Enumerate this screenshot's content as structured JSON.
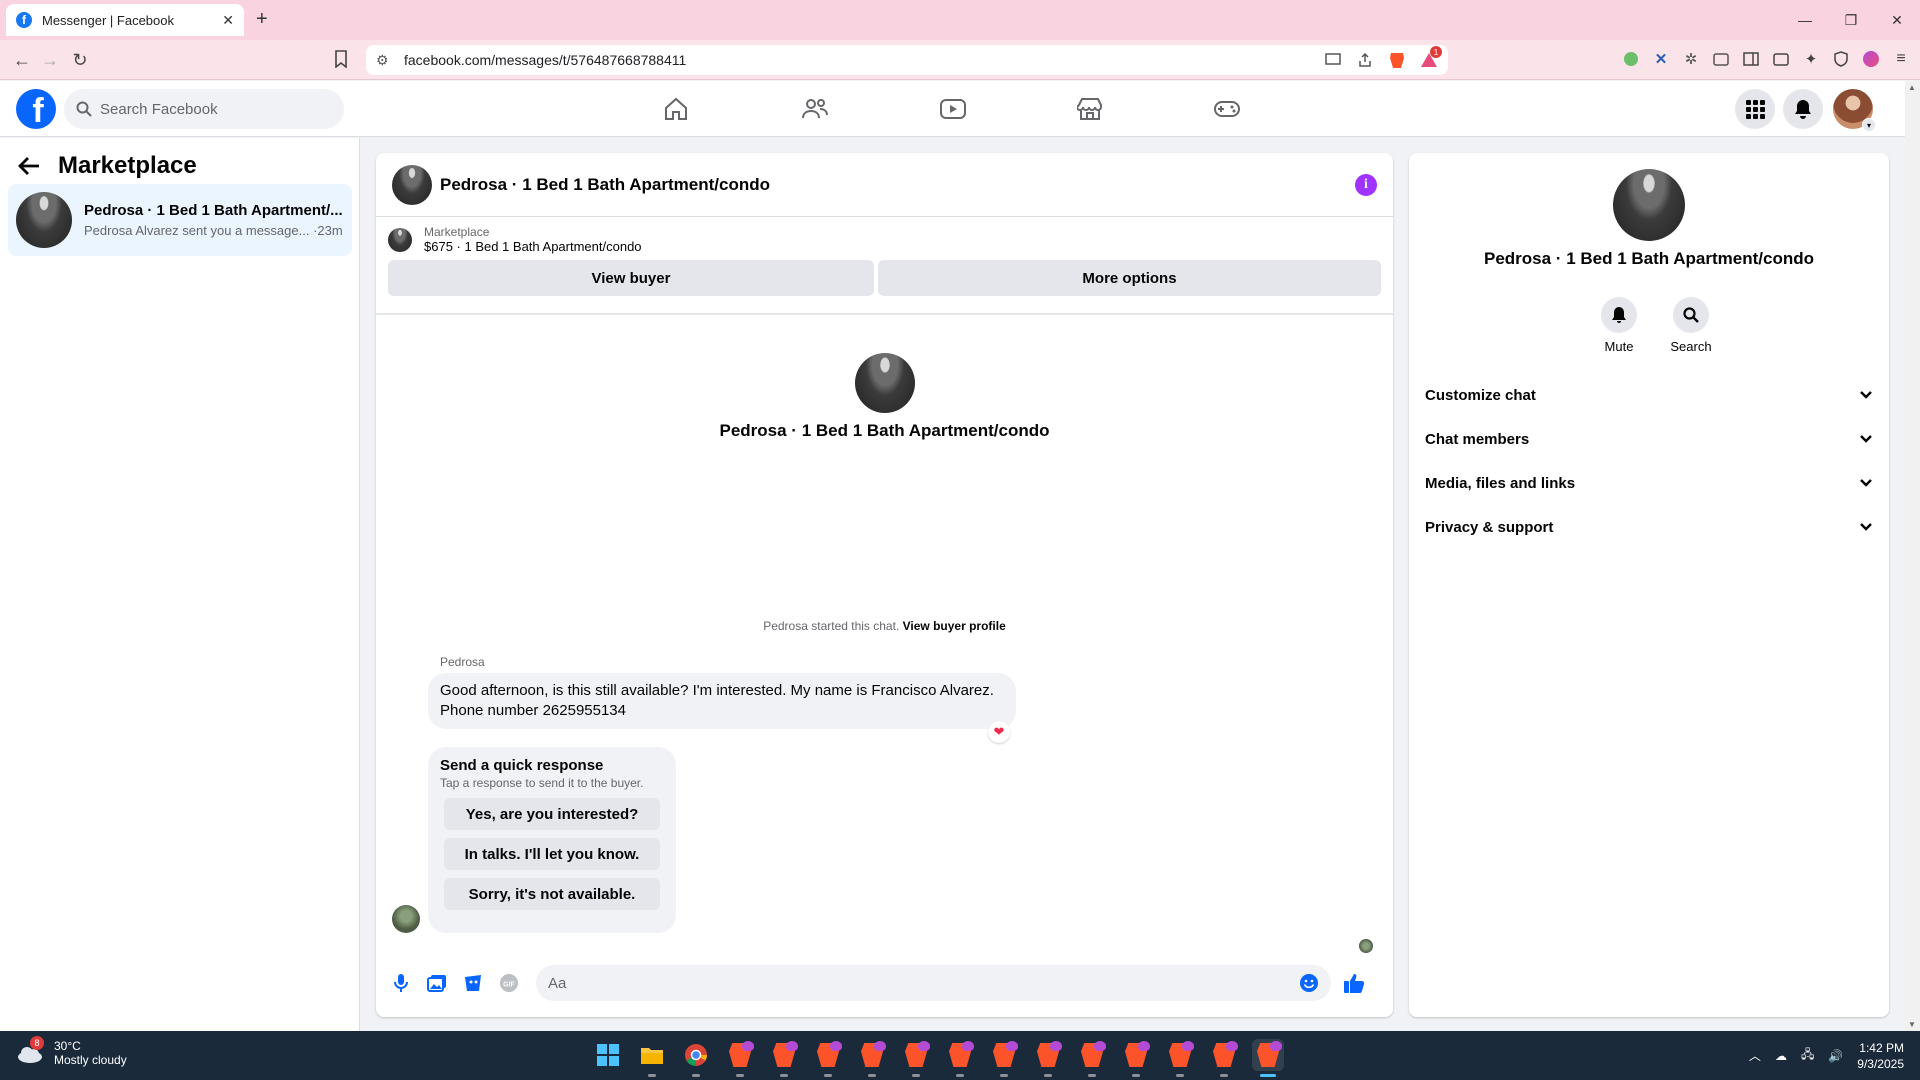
{
  "browser": {
    "tab_title": "Messenger | Facebook",
    "url": "facebook.com/messages/t/576487668788411",
    "ext_badge": "1"
  },
  "fb": {
    "search_placeholder": "Search Facebook",
    "nav": [
      "home-icon",
      "friends-icon",
      "watch-icon",
      "marketplace-icon",
      "gaming-icon"
    ]
  },
  "sidebar": {
    "title": "Marketplace",
    "conversation": {
      "name": "Pedrosa · 1 Bed 1 Bath Apartment/...",
      "preview": "Pedrosa Alvarez sent you a message... ·23m"
    }
  },
  "chat": {
    "title": "Pedrosa · 1 Bed 1 Bath Apartment/condo",
    "listing_category": "Marketplace",
    "listing_price": "$675 · 1 Bed 1 Bath Apartment/condo",
    "view_buyer": "View buyer",
    "more_options": "More options",
    "intro_name": "Pedrosa · 1 Bed 1 Bath Apartment/condo",
    "started_text": "Pedrosa started this chat.",
    "started_link": "View buyer profile",
    "sender": "Pedrosa",
    "message": "Good afternoon, is this still available? I'm interested. My name is Francisco Alvarez. Phone number 2625955134",
    "reaction": "❤",
    "quick_title": "Send a quick response",
    "quick_sub": "Tap a response to send it to the buyer.",
    "quick_responses": [
      "Yes, are you interested?",
      "In talks. I'll let you know.",
      "Sorry, it's not available."
    ],
    "composer_placeholder": "Aa"
  },
  "details": {
    "name": "Pedrosa · 1 Bed 1 Bath Apartment/condo",
    "mute": "Mute",
    "search": "Search",
    "sections": [
      "Customize chat",
      "Chat members",
      "Media, files and links",
      "Privacy & support"
    ]
  },
  "taskbar": {
    "temp": "30°C",
    "weather": "Mostly cloudy",
    "weather_badge": "8",
    "time": "1:42 PM",
    "date": "9/3/2025"
  },
  "colors": {
    "fb_blue": "#0866ff",
    "info_purple": "#a033ff",
    "tab_bar": "#f9d3df"
  }
}
